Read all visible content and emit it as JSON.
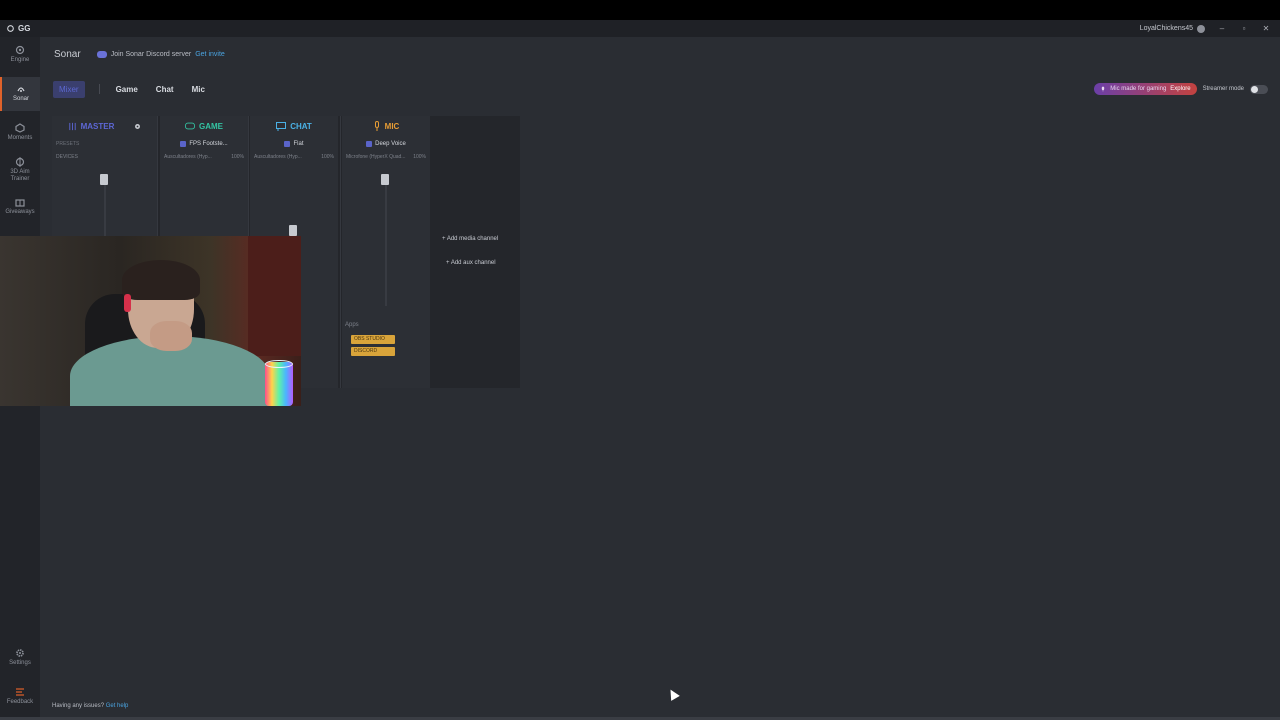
{
  "titlebar": {
    "app_logo": "GG",
    "username": "LoyalChickens45",
    "minimize": "–",
    "maximize": "▫",
    "close": "✕"
  },
  "rail": {
    "items": [
      {
        "label": "Engine",
        "icon": "engine-icon"
      },
      {
        "label": "Sonar",
        "icon": "sonar-icon",
        "active": true
      },
      {
        "label": "Moments",
        "icon": "moments-icon"
      },
      {
        "label": "3D Aim Trainer",
        "icon": "aim-trainer-icon"
      },
      {
        "label": "Giveaways",
        "icon": "giveaways-icon"
      }
    ],
    "settings": "Settings",
    "feedback": "Feedback"
  },
  "header": {
    "title": "Sonar",
    "discord_text": "Join Sonar Discord server",
    "discord_link": "Get invite"
  },
  "tabs": [
    {
      "label": "Mixer",
      "active": true
    },
    {
      "label": "Game"
    },
    {
      "label": "Chat"
    },
    {
      "label": "Mic"
    }
  ],
  "header_right": {
    "mic_promo": "Mic made for gaming",
    "mic_link": "Explore",
    "streamer_mode": "Streamer mode"
  },
  "mixer": {
    "columns": [
      {
        "name": "MASTER",
        "color": "#5d67d6",
        "preset": "",
        "device": "DEVICES",
        "device_level": "",
        "presets_label": "PRESETS"
      },
      {
        "name": "GAME",
        "color": "#33c4a3",
        "preset": "FPS Footste...",
        "device": "Auscultadores (Hyp...",
        "device_level": "100%"
      },
      {
        "name": "CHAT",
        "color": "#4ab1e6",
        "preset": "Flat",
        "device": "Auscultadores (Hyp...",
        "device_level": "100%"
      },
      {
        "name": "MIC",
        "color": "#e69c35",
        "preset": "Deep Voice",
        "device": "Microfone (HyperX Quad...",
        "device_level": "100%"
      }
    ],
    "add_media_channel": "+ Add media channel",
    "add_aux_channel": "+ Add aux channel",
    "apps_label": "Apps",
    "apps": [
      "OBS STUDIO",
      "DISCORD"
    ]
  },
  "footer": {
    "help_text": "Having any issues?",
    "help_link": "Get help"
  }
}
